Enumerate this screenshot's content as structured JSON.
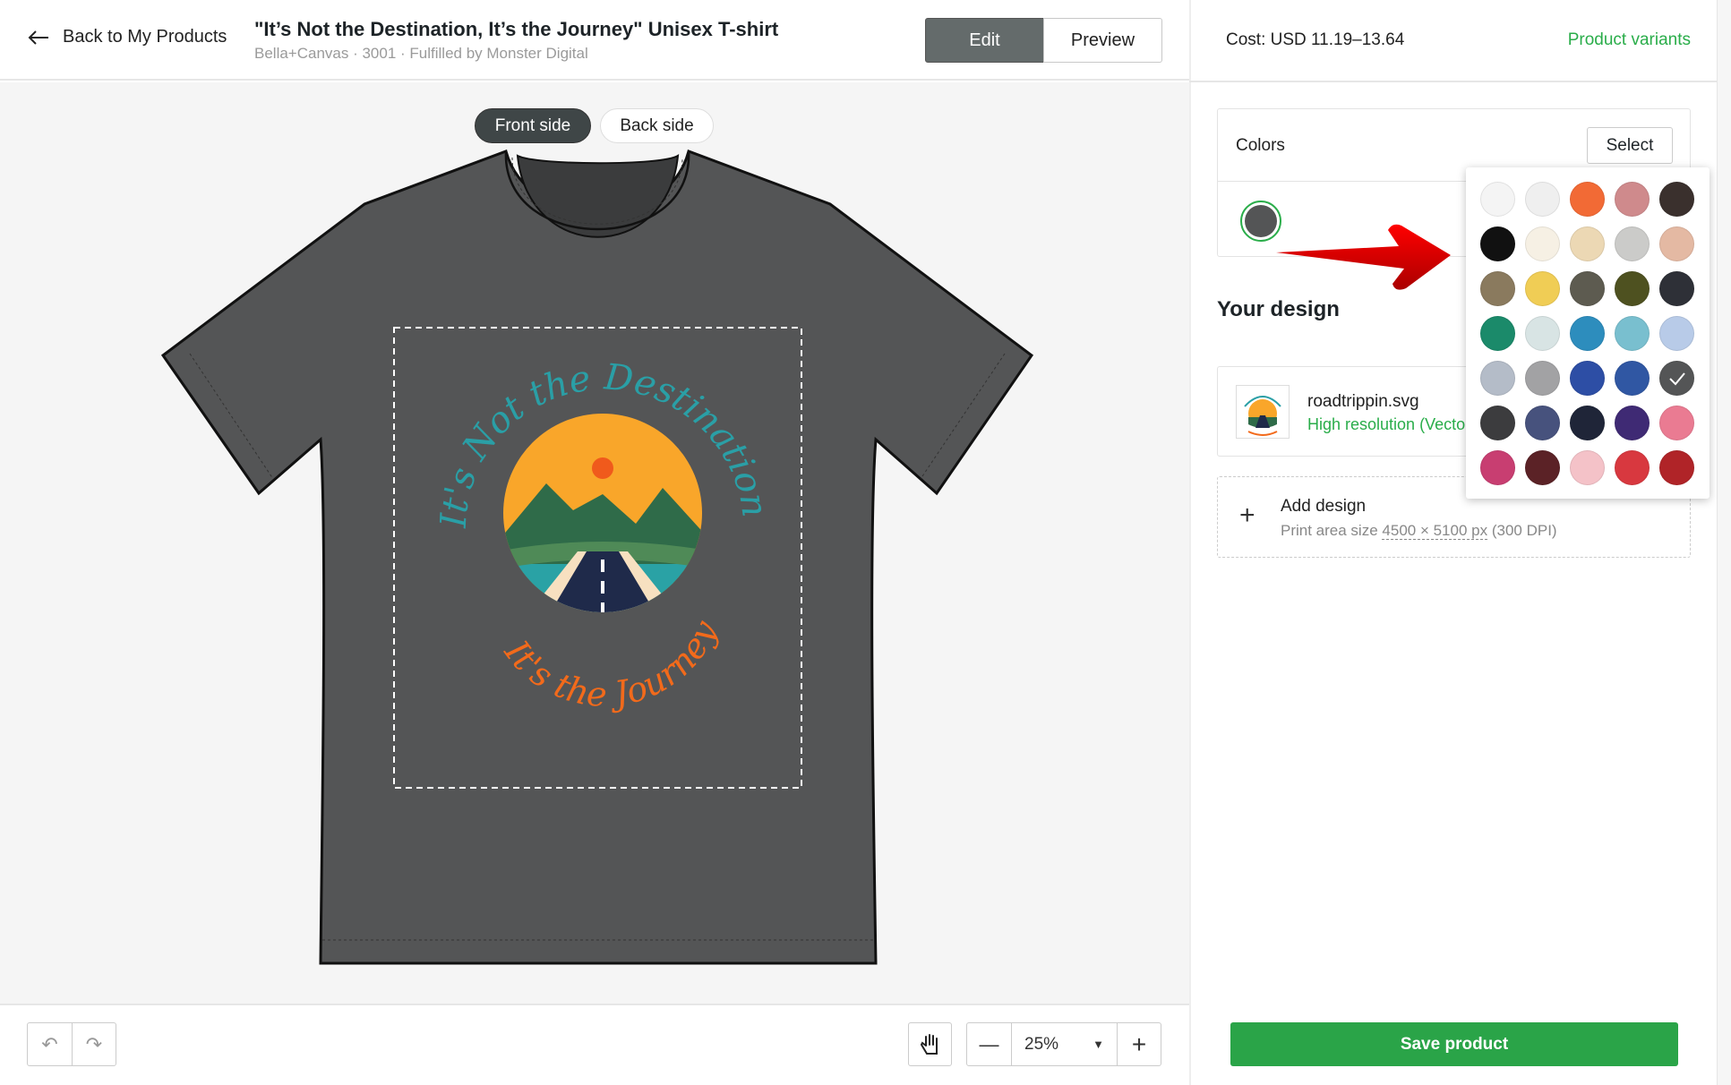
{
  "header": {
    "back_label": "Back to My Products",
    "title": "\"It’s Not the Destination, It’s the Journey\" Unisex T-shirt",
    "subtitle": "Bella+Canvas · 3001 · Fulfilled by Monster Digital",
    "edit_label": "Edit",
    "preview_label": "Preview"
  },
  "canvas": {
    "front_label": "Front side",
    "back_label": "Back side",
    "active_side": "Front side",
    "shirt_color": "#545556",
    "artwork": {
      "top_text": "It's Not the Destination",
      "bottom_text": "It's the Journey",
      "teal": "#2a9fa6",
      "orange": "#f26a1b"
    }
  },
  "toolbar": {
    "undo_icon": "undo-icon",
    "redo_icon": "redo-icon",
    "hand_icon": "hand-icon",
    "zoom_value": "25%"
  },
  "panel": {
    "cost": "Cost: USD 11.19–13.64",
    "variants_link": "Product variants",
    "colors": {
      "label": "Colors",
      "select_label": "Select",
      "selected_color": "#545556",
      "swatches": [
        "#f4f4f4",
        "#efefef",
        "#f26a35",
        "#cf8a8c",
        "#3a302d",
        "#111111",
        "#f6f0e4",
        "#ecd8b4",
        "#cbcbc9",
        "#e4b9a3",
        "#8a7a5e",
        "#f0cd55",
        "#5d5b50",
        "#4e5120",
        "#2e3037",
        "#1b8a6a",
        "#d8e4e4",
        "#2d8dbd",
        "#79bfcf",
        "#b8cbe8",
        "#b4bcc8",
        "#a2a2a4",
        "#2d4ea5",
        "#3057a3",
        "#545556",
        "#3c3c3e",
        "#47527d",
        "#1f2538",
        "#3f2a74",
        "#ea7b92",
        "#c83e71",
        "#5b2226",
        "#f4c2c8",
        "#d8383f",
        "#b02428"
      ],
      "checked_index": 24
    },
    "design_heading": "Your design",
    "design_file": {
      "name": "roadtrippin.svg",
      "quality": "High resolution (Vector)"
    },
    "add_design": {
      "label": "Add design",
      "print_prefix": "Print area size",
      "print_size": "4500 × 5100 px",
      "print_dpi": "(300 DPI)"
    },
    "save_label": "Save product"
  }
}
